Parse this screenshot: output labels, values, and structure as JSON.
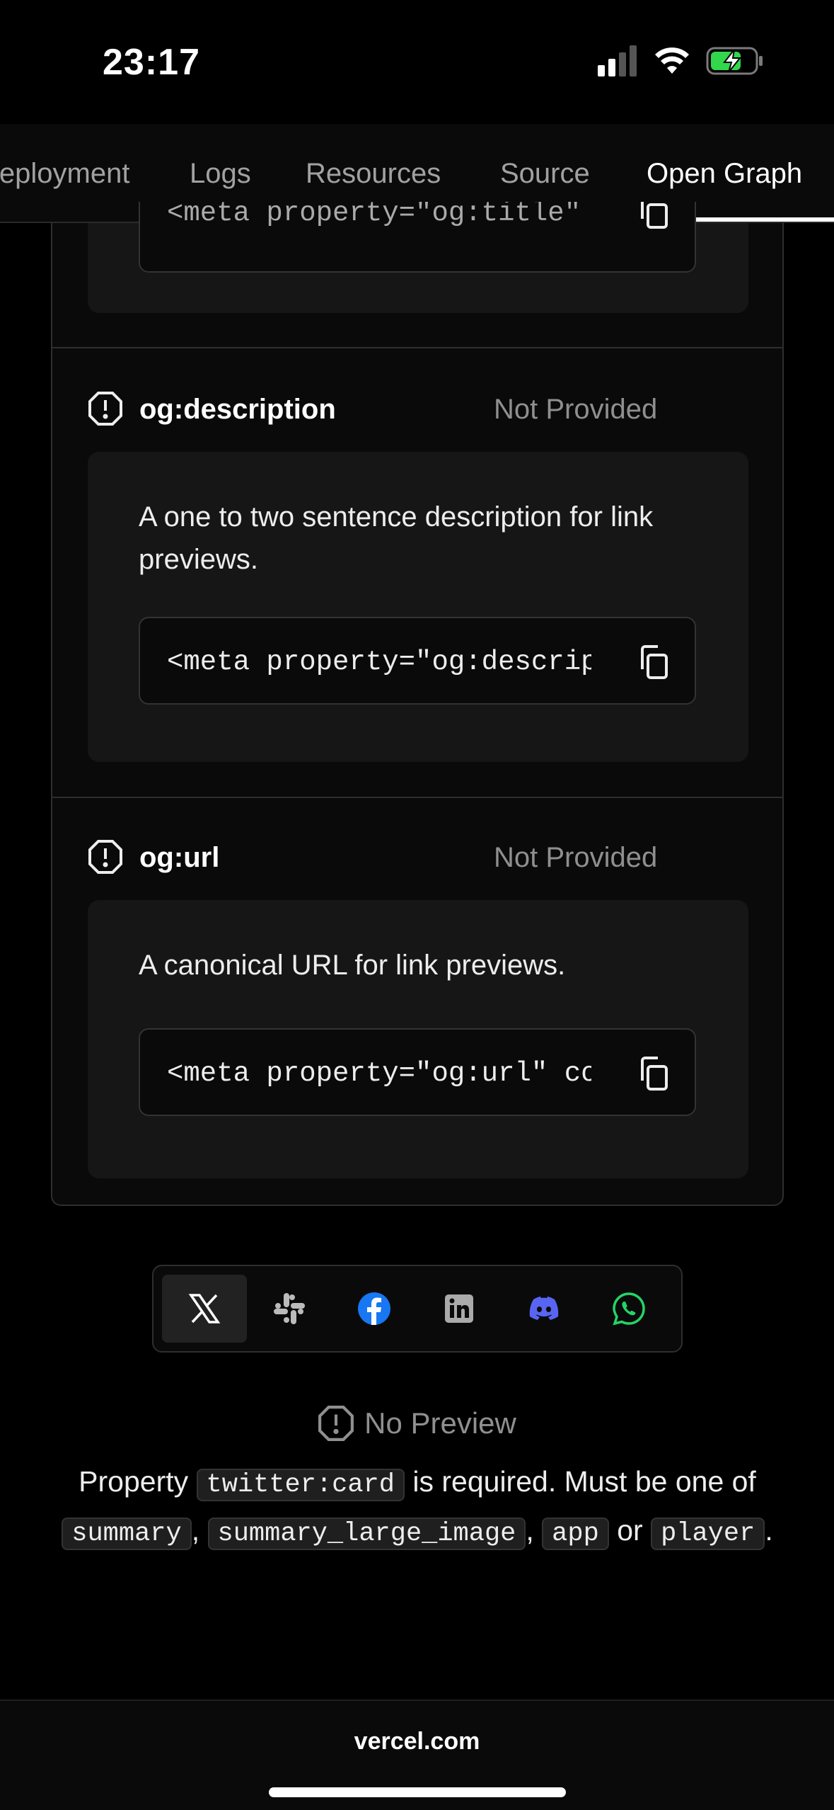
{
  "status_bar": {
    "time": "23:17"
  },
  "tabs": [
    {
      "label": "Deployment"
    },
    {
      "label": "Logs"
    },
    {
      "label": "Resources"
    },
    {
      "label": "Source"
    },
    {
      "label": "Open Graph"
    }
  ],
  "active_tab": "Open Graph",
  "panel": {
    "title_card": {
      "code": "<meta property=\"og:title\""
    },
    "description_prop": {
      "name": "og:description",
      "status": "Not Provided",
      "description": "A one to two sentence description for link previews.",
      "code": "<meta property=\"og:descrip"
    },
    "url_prop": {
      "name": "og:url",
      "status": "Not Provided",
      "description": "A canonical URL for link previews.",
      "code": "<meta property=\"og:url\" co"
    }
  },
  "share_platforms": [
    {
      "name": "x-icon"
    },
    {
      "name": "slack-icon"
    },
    {
      "name": "facebook-icon"
    },
    {
      "name": "linkedin-icon"
    },
    {
      "name": "discord-icon"
    },
    {
      "name": "whatsapp-icon"
    }
  ],
  "preview": {
    "no_preview_label": "No Preview",
    "note_prefix": "Property",
    "note_chip_1": "twitter:card",
    "note_mid": "is required. Must be one of",
    "chip_summary": "summary",
    "chip_summary_large": "summary_large_image",
    "chip_app": "app",
    "or_word": "or",
    "chip_player": "player"
  },
  "browser": {
    "url": "vercel.com"
  },
  "colors": {
    "background": "#000000",
    "facebook": "#1877f2",
    "discord": "#5865f2",
    "whatsapp": "#25d366",
    "battery_charge": "#32d74b"
  }
}
